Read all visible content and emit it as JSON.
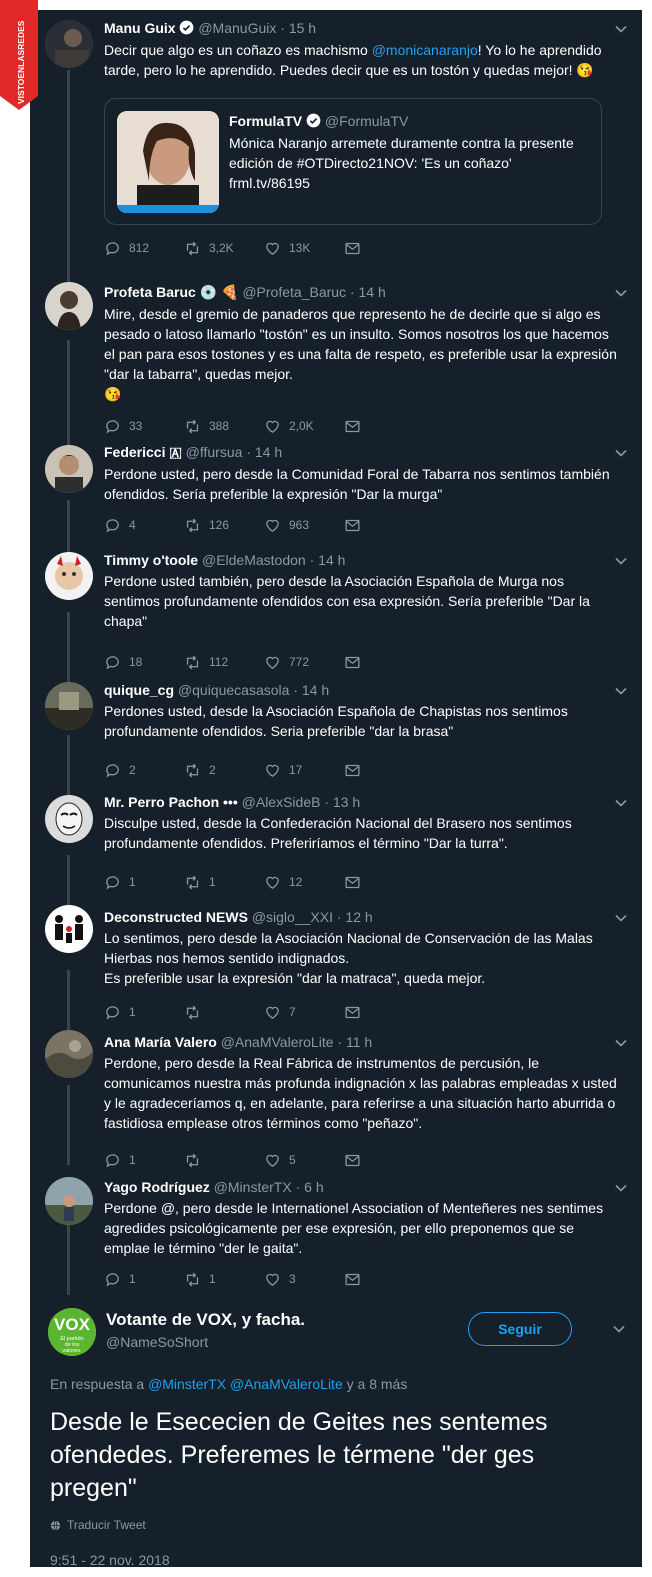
{
  "watermark": "VISTOENLASREDES",
  "colors": {
    "bg": "#15202b",
    "accent": "#1da1f2",
    "muted": "#8899a6",
    "line": "#38444d"
  },
  "thread": [
    {
      "name": "Manu Guix",
      "verified": true,
      "handle": "@ManuGuix",
      "time": "15 h",
      "text_before": "Decir que algo es un coñazo es machismo ",
      "mention": "@monicanaranjo",
      "text_after": "! Yo lo he aprendido tarde, pero lo he aprendido. Puedes decir que es un tostón y quedas mejor! 😘",
      "quote": {
        "name": "FormulaTV",
        "handle": "@FormulaTV",
        "text": "Mónica Naranjo arremete duramente contra la presente edición de #OTDirecto21NOV: 'Es un coñazo' frml.tv/86195"
      },
      "replies": "812",
      "retweets": "3,2K",
      "likes": "13K"
    },
    {
      "name": "Profeta Baruc 💿 🍕",
      "handle": "@Profeta_Baruc",
      "time": "14 h",
      "text": "Mire, desde el gremio de panaderos que represento he de decirle que si algo es pesado o latoso llamarlo \"tostón\" es un insulto. Somos nosotros los que hacemos el pan para esos tostones y es una falta de respeto, es preferible usar la expresión \"dar la tabarra\", quedas mejor.\n😘",
      "replies": "33",
      "retweets": "388",
      "likes": "2,0K"
    },
    {
      "name": "Federicci 🇦",
      "handle": "@ffursua",
      "time": "14 h",
      "text": "Perdone usted, pero desde la Comunidad Foral de Tabarra nos sentimos también ofendidos. Sería preferible la expresión \"Dar la murga\"",
      "replies": "4",
      "retweets": "126",
      "likes": "963"
    },
    {
      "name": "Timmy o'toole",
      "handle": "@EldeMastodon",
      "time": "14 h",
      "text": "Perdone usted también, pero desde la Asociación Española de Murga nos sentimos profundamente ofendidos con esa expresión. Sería preferible \"Dar la chapa\"",
      "replies": "18",
      "retweets": "112",
      "likes": "772"
    },
    {
      "name": "quique_cg",
      "handle": "@quiquecasasola",
      "time": "14 h",
      "text": "Perdones usted, desde la Asociación Española de Chapistas nos sentimos profundamente ofendidos. Seria preferible \"dar la brasa\"",
      "replies": "2",
      "retweets": "2",
      "likes": "17"
    },
    {
      "name": "Mr. Perro Pachon •••",
      "handle": "@AlexSideB",
      "time": "13 h",
      "text": "Disculpe usted, desde la Confederación Nacional del Brasero nos sentimos profundamente ofendidos. Preferiríamos el término \"Dar la turra\".",
      "replies": "1",
      "retweets": "1",
      "likes": "12"
    },
    {
      "name": "Deconstructed NEWS",
      "handle": "@siglo__XXI",
      "time": "12 h",
      "text": "Lo sentimos, pero desde la Asociación Nacional de Conservación de las Malas Hierbas nos hemos sentido indignados.\nEs preferible usar la expresión \"dar la matraca\", queda mejor.",
      "replies": "1",
      "retweets": "",
      "likes": "7"
    },
    {
      "name": "Ana María Valero",
      "handle": "@AnaMValeroLite",
      "time": "11 h",
      "text": "Perdone, pero desde la Real Fábrica de instrumentos de percusión, le comunicamos nuestra más profunda indignación x las palabras empleadas x usted y le agradeceríamos q, en adelante, para referirse a una situación harto aburrida o fastidiosa emplease otros términos como \"peñazo\".",
      "replies": "1",
      "retweets": "",
      "likes": "5"
    },
    {
      "name": "Yago Rodríguez",
      "handle": "@MinsterTX",
      "time": "6 h",
      "text": "Perdone @, pero desde le Internationel Association of Menteñeres nes sentimes agredides psicológicamente per ese expresión, per ello preponemos que se emplae le término \"der le gaita\".",
      "replies": "1",
      "retweets": "1",
      "likes": "3"
    }
  ],
  "main": {
    "name": "Votante de VOX, y facha.",
    "handle": "@NameSoShort",
    "avatar_text": "El partido de los valores.",
    "follow": "Seguir",
    "reply_prefix": "En respuesta a ",
    "reply_mentions": "@MinsterTX @AnaMValeroLite",
    "reply_suffix": " y a 8 más",
    "text": "Desde le Esececien de Geites nes sentemes ofendedes. Preferemes le térmene \"der ges pregen\"",
    "translate": "Traducir Tweet",
    "timestamp": "9:51 - 22 nov. 2018"
  }
}
